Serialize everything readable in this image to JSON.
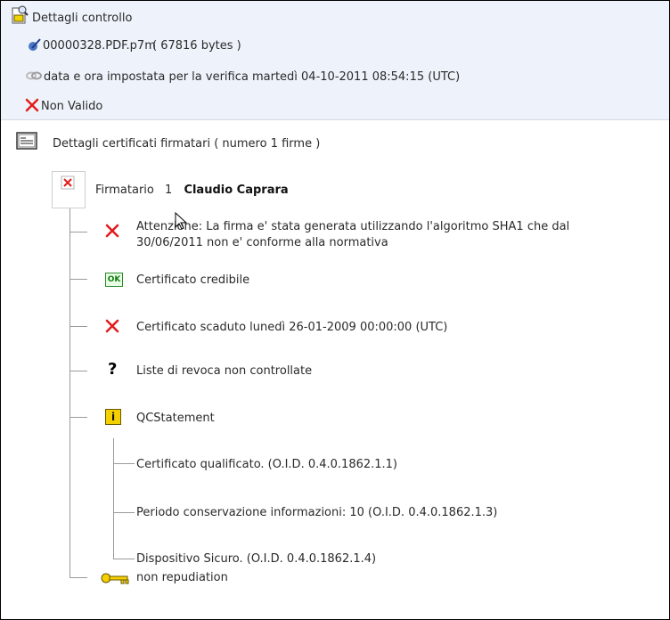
{
  "top": {
    "title": "Dettagli controllo",
    "file_name": "00000328.PDF.p7m",
    "file_size": "( 67816  bytes )",
    "verification_time": "data e ora impostata per la verifica martedì 04-10-2011 08:54:15 (UTC)",
    "result": "Non Valido"
  },
  "certificates": {
    "header": "Dettagli certificati firmatari ( numero 1 firme )",
    "signer_prefix": "Firmatario",
    "signer_number": "1",
    "signer_name": "Claudio Caprara",
    "items": {
      "warning_line1": "Attenzione: La firma e' stata generata utilizzando l'algoritmo SHA1 che dal",
      "warning_line2": "30/06/2011 non e' conforme alla normativa",
      "credible": "Certificato credibile",
      "expired": "Certificato scaduto lunedì 26-01-2009 00:00:00 (UTC)",
      "revocation": "Liste di revoca non controllate",
      "qc": "QCStatement",
      "qc_items": [
        "Certificato qualificato. (O.I.D. 0.4.0.1862.1.1)",
        "Periodo conservazione informazioni: 10 (O.I.D. 0.4.0.1862.1.3)",
        "Dispositivo Sicuro. (O.I.D. 0.4.0.1862.1.4)"
      ],
      "nonrep": "non repudiation"
    }
  },
  "badges": {
    "ok": "OK",
    "info": "i",
    "question": "?"
  },
  "colors": {
    "red": "#e21b1b",
    "panel": "#eef3fb",
    "ok_green": "#2a8a2a",
    "info_yellow": "#f4d000"
  }
}
